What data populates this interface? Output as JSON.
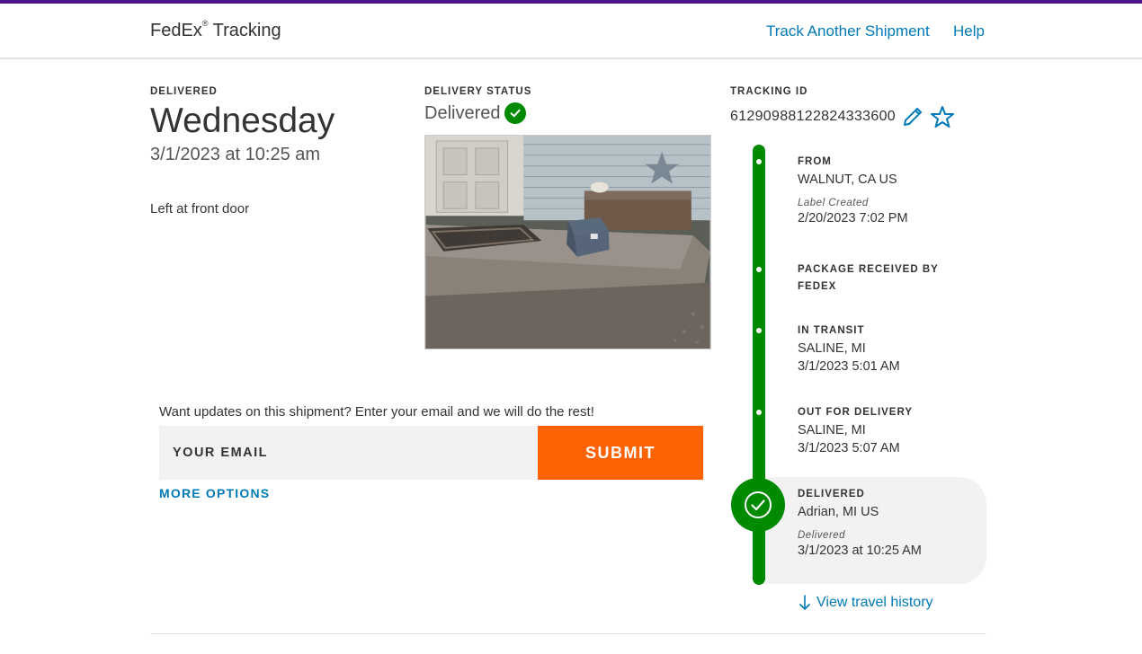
{
  "header": {
    "brand": "FedEx",
    "brand_mark": "®",
    "brand_suffix": "Tracking",
    "nav": {
      "track_another": "Track Another Shipment",
      "help": "Help"
    }
  },
  "delivery": {
    "label": "DELIVERED",
    "day": "Wednesday",
    "datetime": "3/1/2023 at 10:25 am",
    "location_note": "Left at front door"
  },
  "status": {
    "label": "DELIVERY STATUS",
    "value": "Delivered",
    "icon": "check-circle-icon"
  },
  "tracking": {
    "label": "TRACKING ID",
    "id": "612909881228243336 00",
    "edit_icon": "pencil-icon",
    "favorite_icon": "star-icon"
  },
  "timeline": {
    "steps": [
      {
        "title": "FROM",
        "line1": "WALNUT, CA US",
        "sub": "Label Created",
        "line2": "2/20/2023 7:02 PM"
      },
      {
        "title": "PACKAGE RECEIVED BY",
        "title2": "FEDEX"
      },
      {
        "title": "IN TRANSIT",
        "line1": "SALINE, MI",
        "line2": "3/1/2023 5:01 AM"
      },
      {
        "title": "OUT FOR DELIVERY",
        "line1": "SALINE, MI",
        "line2": "3/1/2023 5:07 AM"
      },
      {
        "title": "DELIVERED",
        "line1": "Adrian, MI US",
        "sub": "Delivered",
        "line2": "3/1/2023 at 10:25 AM"
      }
    ],
    "history_link": "View travel history"
  },
  "email_signup": {
    "prompt": "Want updates on this shipment? Enter your email and we will do the rest!",
    "placeholder": "YOUR EMAIL",
    "submit_label": "SUBMIT",
    "more_options": "MORE OPTIONS"
  },
  "colors": {
    "brand_purple": "#4d148c",
    "link_blue": "#007ab7",
    "success_green": "#008a00",
    "submit_orange": "#ff6200"
  }
}
